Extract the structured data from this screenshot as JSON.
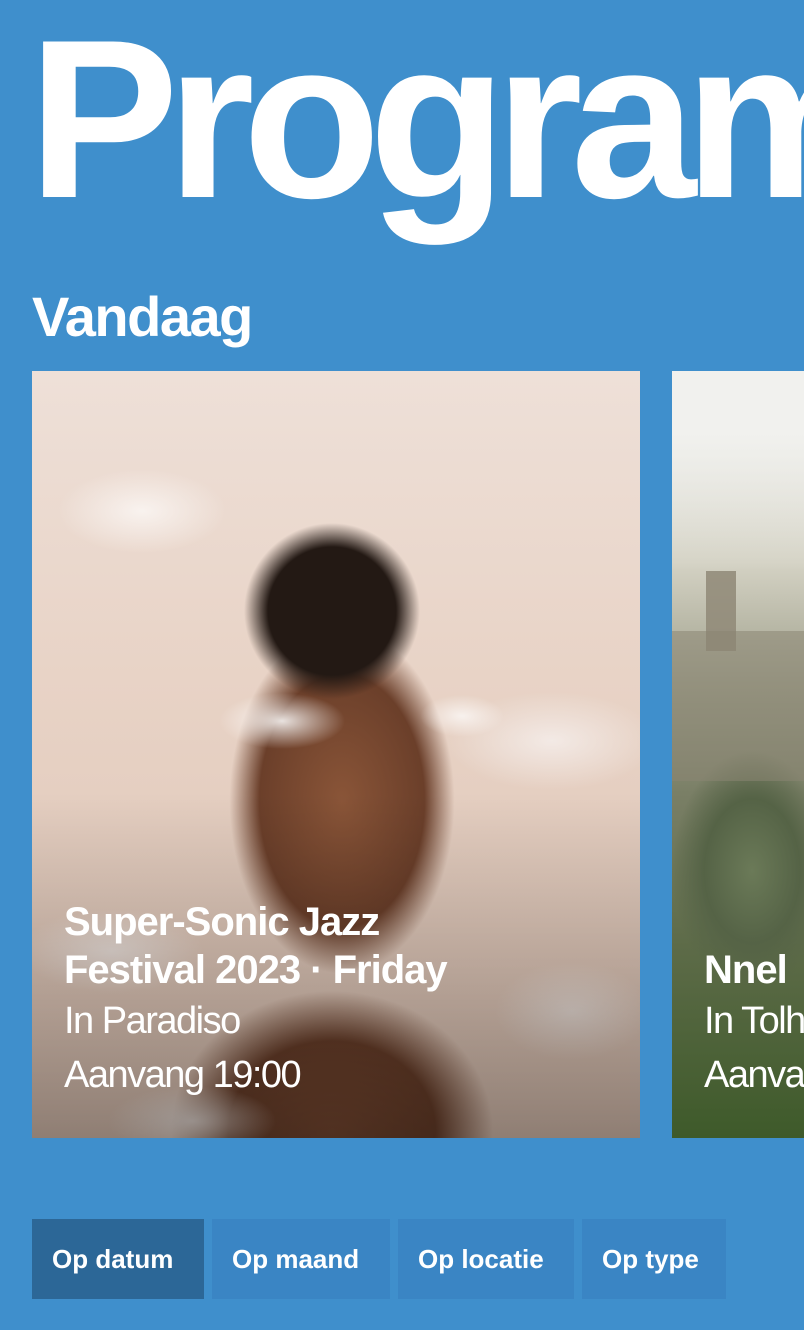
{
  "header": {
    "title": "Program"
  },
  "section": {
    "title": "Vandaag"
  },
  "events": [
    {
      "title": "Super-Sonic Jazz\nFestival 2023 · Friday",
      "location": "In Paradiso",
      "start": "Aanvang 19:00"
    },
    {
      "title": "Nnel",
      "location": "In Tolh",
      "start": "Aanva"
    }
  ],
  "filters": [
    {
      "label": "Op datum",
      "active": true
    },
    {
      "label": "Op maand",
      "active": false
    },
    {
      "label": "Op locatie",
      "active": false
    },
    {
      "label": "Op type",
      "active": false
    }
  ],
  "colors": {
    "background": "#3f8fcc",
    "filter_button": "#3a85c4",
    "filter_button_active": "#2c6797",
    "text": "#ffffff"
  }
}
